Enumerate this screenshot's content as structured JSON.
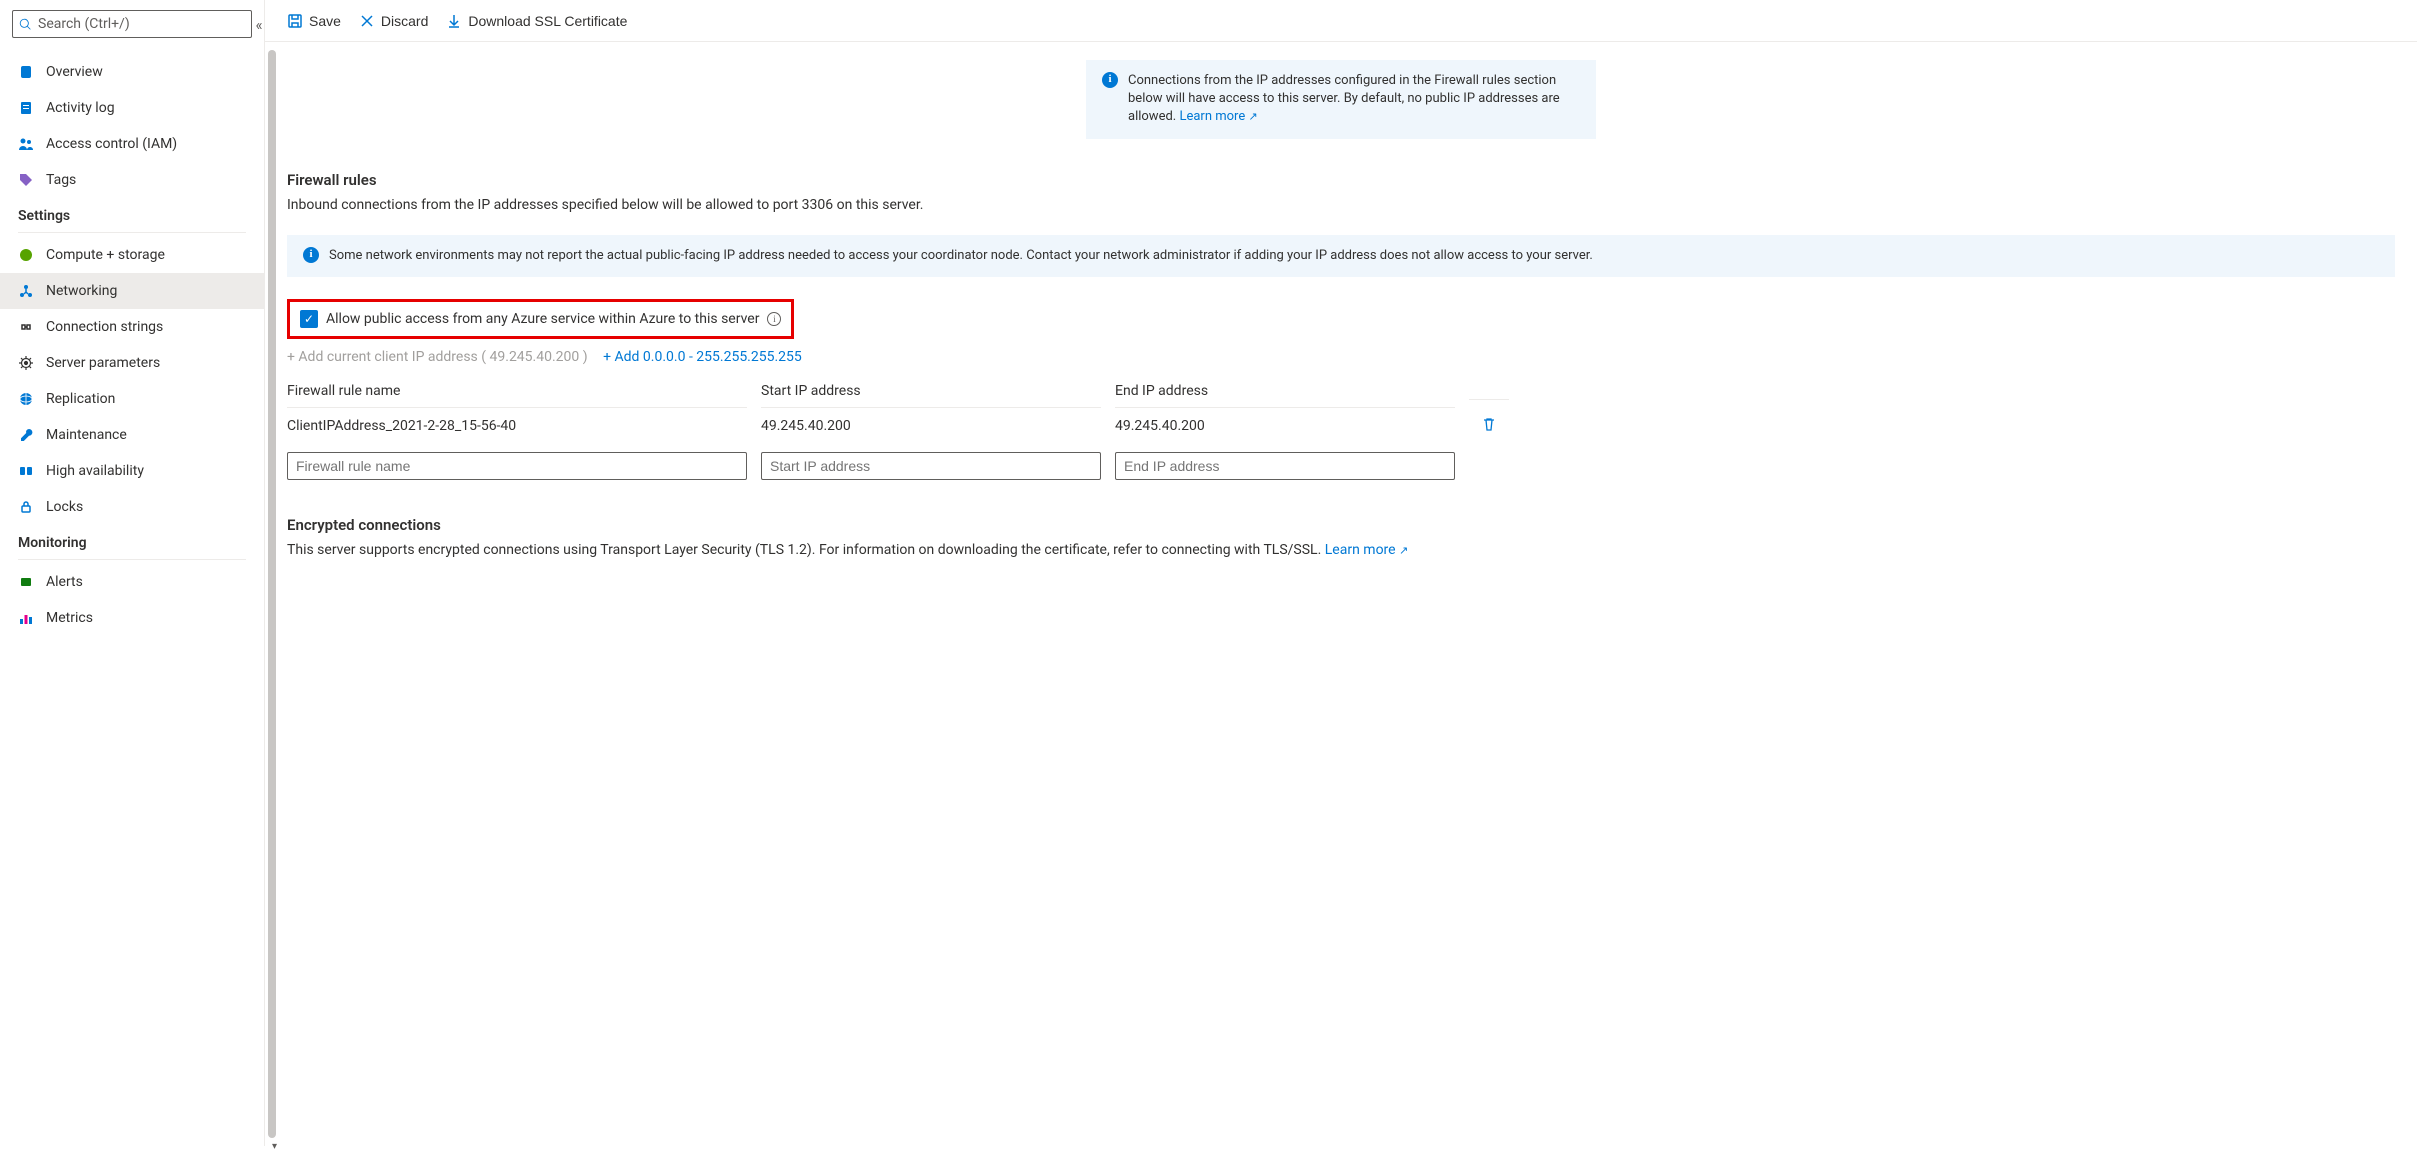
{
  "sidebar": {
    "search_placeholder": "Search (Ctrl+/)",
    "items_top": [
      {
        "label": "Overview"
      },
      {
        "label": "Activity log"
      },
      {
        "label": "Access control (IAM)"
      },
      {
        "label": "Tags"
      }
    ],
    "section_settings": "Settings",
    "items_settings": [
      {
        "label": "Compute + storage"
      },
      {
        "label": "Networking",
        "active": true
      },
      {
        "label": "Connection strings"
      },
      {
        "label": "Server parameters"
      },
      {
        "label": "Replication"
      },
      {
        "label": "Maintenance"
      },
      {
        "label": "High availability"
      },
      {
        "label": "Locks"
      }
    ],
    "section_monitoring": "Monitoring",
    "items_monitoring": [
      {
        "label": "Alerts"
      },
      {
        "label": "Metrics"
      }
    ]
  },
  "toolbar": {
    "save": "Save",
    "discard": "Discard",
    "download": "Download SSL Certificate"
  },
  "info1": {
    "text": "Connections from the IP addresses configured in the Firewall rules section below will have access to this server. By default, no public IP addresses are allowed. ",
    "link": "Learn more"
  },
  "firewall": {
    "title": "Firewall rules",
    "desc": "Inbound connections from the IP addresses specified below will be allowed to port 3306 on this server."
  },
  "info2": {
    "text": "Some network environments may not report the actual public-facing IP address needed to access your coordinator node. Contact your network administrator if adding your IP address does not allow access to your server."
  },
  "allow_azure": {
    "label": "Allow public access from any Azure service within Azure to this server"
  },
  "ip_actions": {
    "add_current": "+ Add current client IP address ( 49.245.40.200 )",
    "add_all": "+ Add 0.0.0.0 - 255.255.255.255"
  },
  "table": {
    "headers": {
      "name": "Firewall rule name",
      "start": "Start IP address",
      "end": "End IP address"
    },
    "row": {
      "name": "ClientIPAddress_2021-2-28_15-56-40",
      "start": "49.245.40.200",
      "end": "49.245.40.200"
    },
    "placeholders": {
      "name": "Firewall rule name",
      "start": "Start IP address",
      "end": "End IP address"
    }
  },
  "encrypted": {
    "title": "Encrypted connections",
    "desc": "This server supports encrypted connections using Transport Layer Security (TLS 1.2). For information on downloading the certificate, refer to connecting with TLS/SSL. ",
    "link": "Learn more"
  }
}
